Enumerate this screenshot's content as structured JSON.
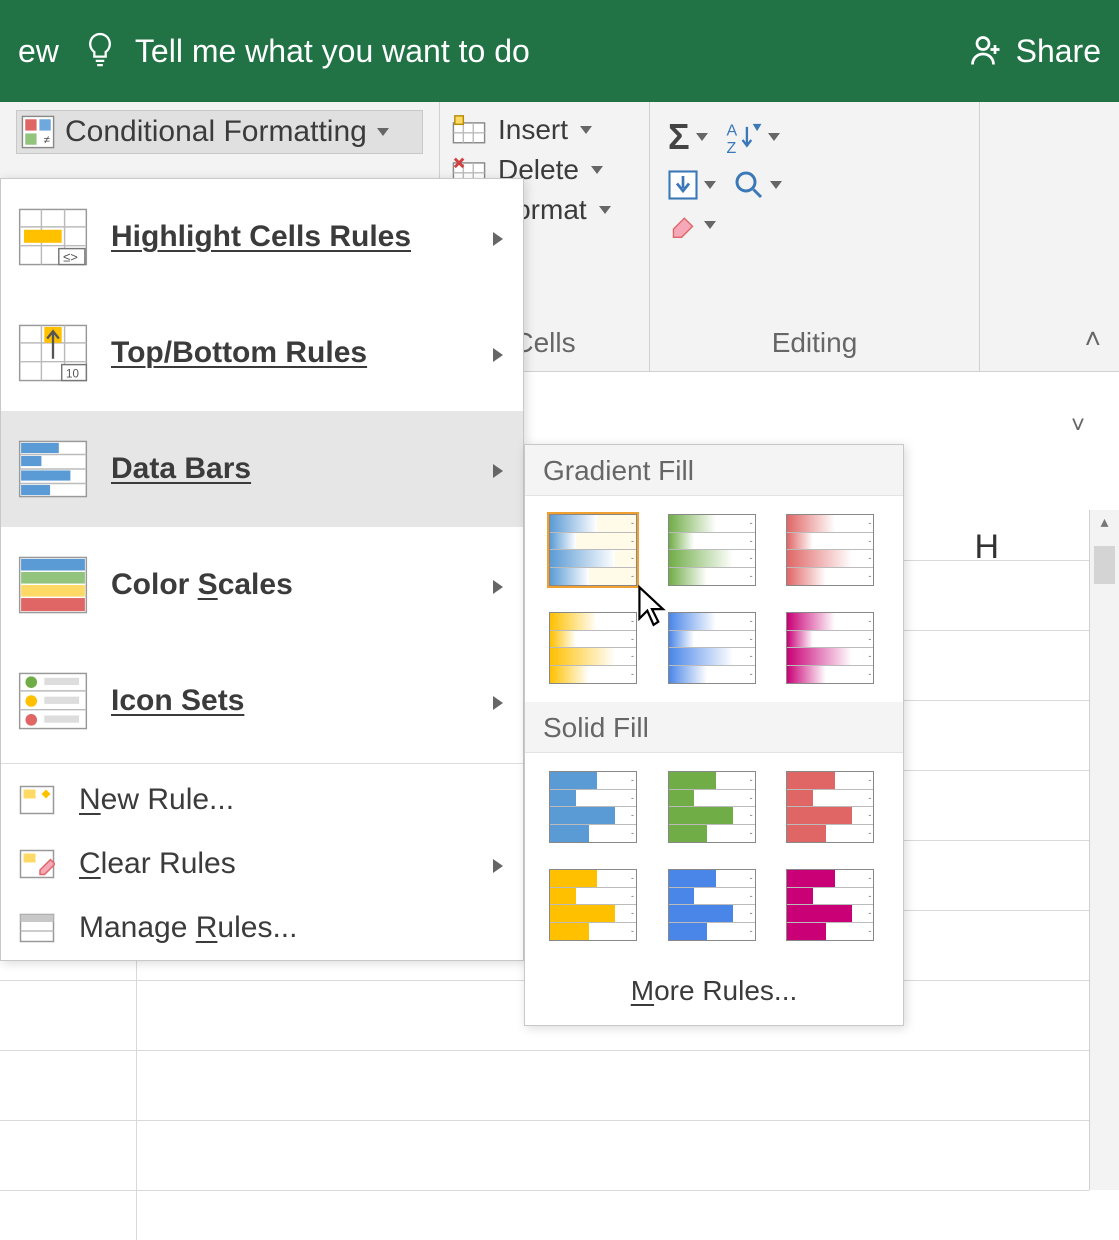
{
  "titlebar": {
    "view_fragment": "ew",
    "tell_me": "Tell me what you want to do",
    "share": "Share"
  },
  "ribbon": {
    "conditional_formatting": "Conditional Formatting",
    "cells_group": {
      "insert": "Insert",
      "delete": "Delete",
      "format": "Format",
      "label": "Cells"
    },
    "editing_group": {
      "label": "Editing"
    }
  },
  "menu": {
    "highlight": "Highlight Cells Rules",
    "topbottom": "Top/Bottom Rules",
    "databars": "Data Bars",
    "colorscales": "Color Scales",
    "iconsets": "Icon Sets",
    "newrule": "New Rule...",
    "clear": "Clear Rules",
    "manage": "Manage Rules..."
  },
  "submenu": {
    "gradient": "Gradient Fill",
    "solid": "Solid Fill",
    "more": "More Rules..."
  },
  "databar_colors": {
    "gradient": [
      "#5b9bd5",
      "#70ad47",
      "#e06666",
      "#ffc000",
      "#4a86e8",
      "#c90076"
    ],
    "solid": [
      "#5b9bd5",
      "#70ad47",
      "#e06666",
      "#ffc000",
      "#4a86e8",
      "#c90076"
    ]
  },
  "sheet": {
    "column_visible": "H"
  }
}
